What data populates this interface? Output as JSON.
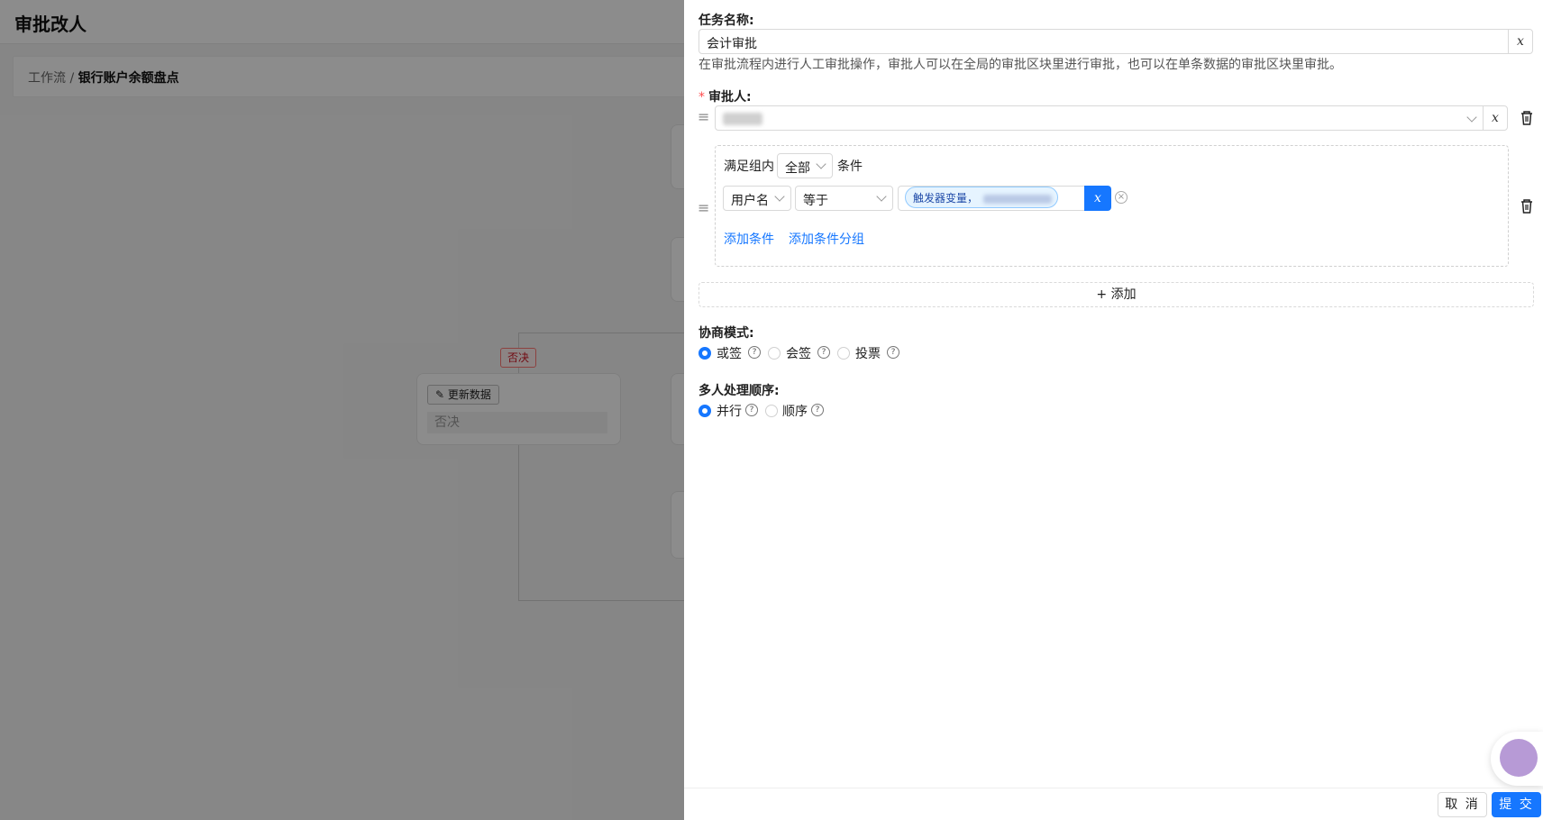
{
  "page": {
    "title": "审批改人",
    "breadcrumb": {
      "parent": "工作流",
      "separator": " / ",
      "current": "银行账户余额盘点"
    }
  },
  "canvas": {
    "reject_tag": "否决",
    "update_node": {
      "button": "更新数据",
      "text": "否决"
    }
  },
  "drawer": {
    "task_name": {
      "label": "任务名称",
      "value": "会计审批",
      "x_label": "x",
      "help": "在审批流程内进行人工审批操作，审批人可以在全局的审批区块里进行审批，也可以在单条数据的审批区块里审批。"
    },
    "assignees": {
      "label": "审批人",
      "x_label": "x",
      "group": {
        "prefix": "满足组内",
        "match_value": "全部",
        "suffix": "条件",
        "condition": {
          "field": "用户名",
          "operator": "等于",
          "value_tag": "触发器变量，",
          "x_label": "x"
        },
        "add_condition": "添加条件",
        "add_group": "添加条件分组"
      },
      "add_button": "+ 添加"
    },
    "negotiation": {
      "label": "协商模式",
      "options": [
        {
          "label": "或签",
          "selected": true
        },
        {
          "label": "会签",
          "selected": false
        },
        {
          "label": "投票",
          "selected": false
        }
      ]
    },
    "order": {
      "label": "多人处理顺序",
      "options": [
        {
          "label": "并行",
          "selected": true
        },
        {
          "label": "顺序",
          "selected": false
        }
      ]
    },
    "footer": {
      "cancel": "取 消",
      "submit": "提 交"
    }
  },
  "colors": {
    "primary": "#1677ff",
    "danger": "#ff4d4f",
    "overlay": "rgba(0,0,0,0.45)"
  }
}
